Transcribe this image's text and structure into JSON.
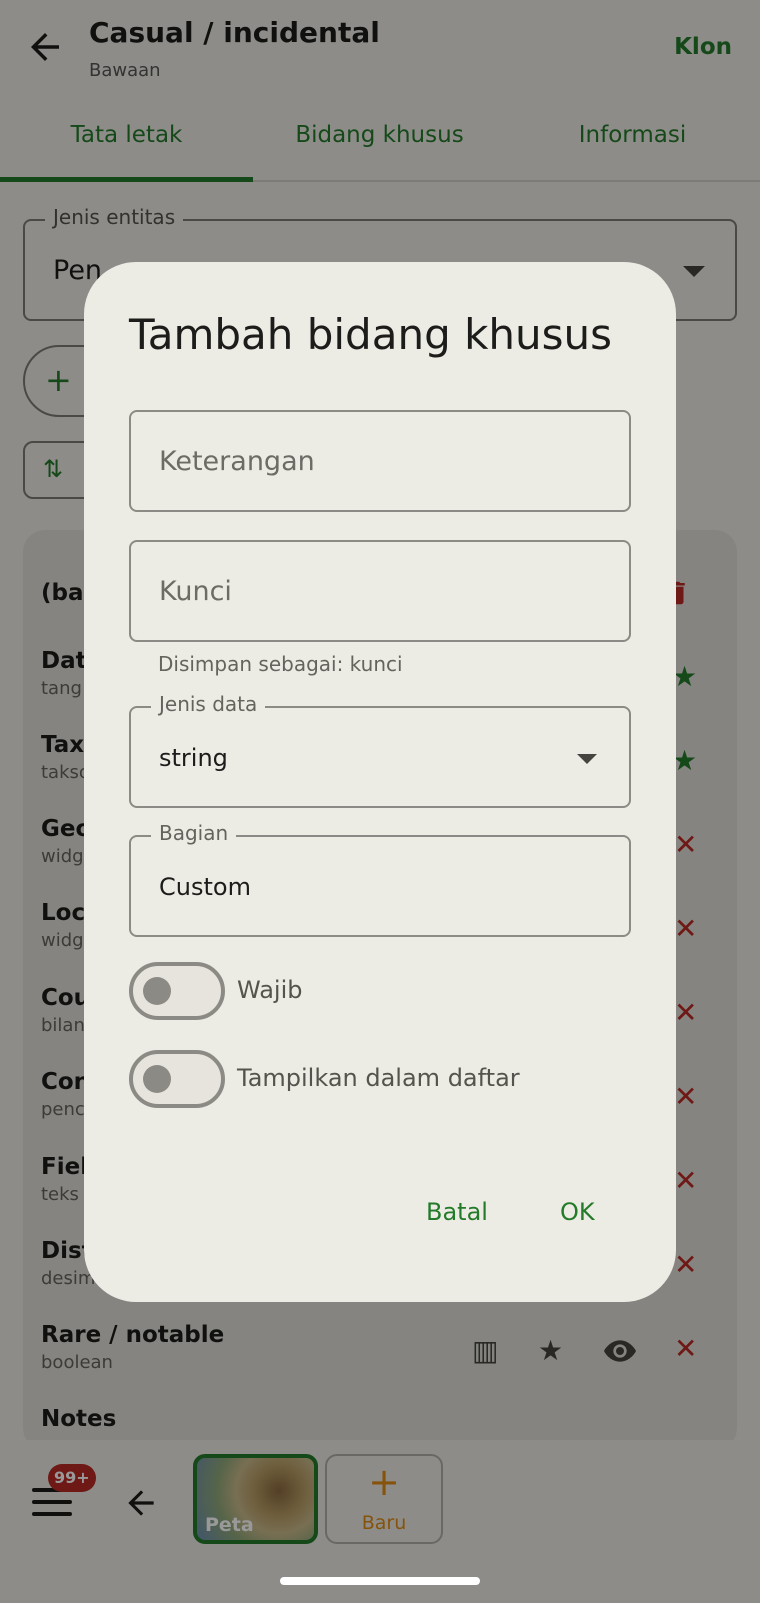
{
  "appbar": {
    "title": "Casual / incidental",
    "subtitle": "Bawaan",
    "action": "Klon"
  },
  "tabs": [
    "Tata letak",
    "Bidang khusus",
    "Informasi"
  ],
  "entity_field": {
    "label": "Jenis entitas",
    "value": "Pen"
  },
  "fields_list": {
    "group_label": "(bag",
    "rows": [
      {
        "name": "Date",
        "type": "tang"
      },
      {
        "name": "Taxo",
        "type": "takso"
      },
      {
        "name": "Geo",
        "type": "widg"
      },
      {
        "name": "Loc",
        "type": "widg"
      },
      {
        "name": "Cou",
        "type": "bilan"
      },
      {
        "name": "Con",
        "type": "penc"
      },
      {
        "name": "Fiel",
        "type": "teks"
      },
      {
        "name": "Dist",
        "type": "desima"
      },
      {
        "name": "Rare / notable",
        "type": "boolean"
      },
      {
        "name": "Notes",
        "type": ""
      }
    ]
  },
  "bottom_bar": {
    "badge": "99+",
    "map_label": "Peta",
    "new_label": "Baru"
  },
  "dialog": {
    "title": "Tambah bidang khusus",
    "description_placeholder": "Keterangan",
    "key_placeholder": "Kunci",
    "saved_as": "Disimpan sebagai: kunci",
    "data_type_label": "Jenis data",
    "data_type_value": "string",
    "section_label": "Bagian",
    "section_value": "Custom",
    "required_label": "Wajib",
    "show_in_list_label": "Tampilkan dalam daftar",
    "cancel": "Batal",
    "ok": "OK"
  },
  "colors": {
    "accent": "#237b2a",
    "danger": "#b72a24",
    "orange": "#e08a16"
  }
}
